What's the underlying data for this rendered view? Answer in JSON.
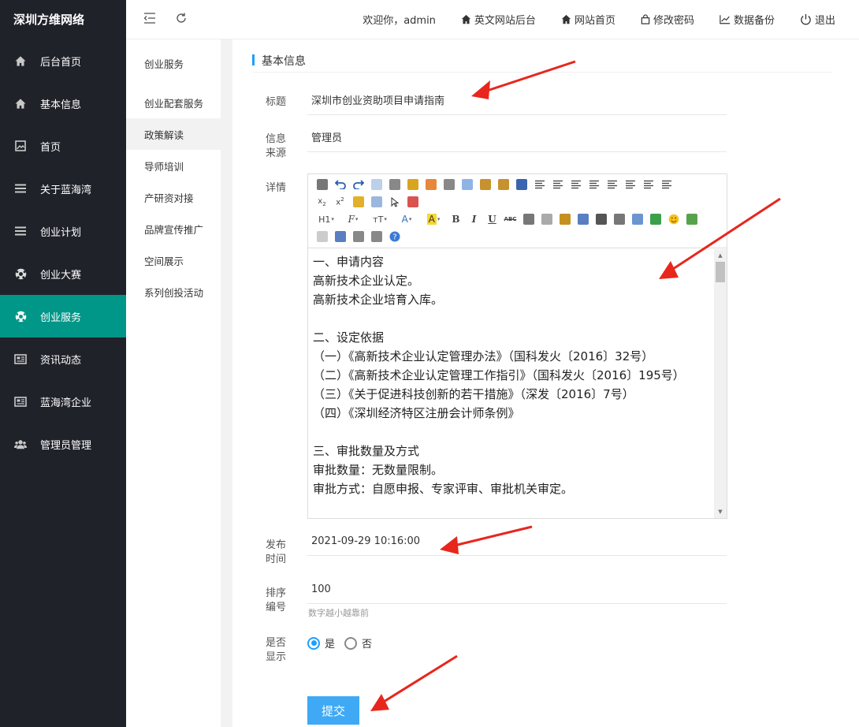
{
  "brand": "深圳方维网络",
  "sidebar": {
    "items": [
      {
        "label": "后台首页",
        "icon": "home-icon"
      },
      {
        "label": "基本信息",
        "icon": "home-icon"
      },
      {
        "label": "首页",
        "icon": "image-icon"
      },
      {
        "label": "关于蓝海湾",
        "icon": "list-icon"
      },
      {
        "label": "创业计划",
        "icon": "list-icon"
      },
      {
        "label": "创业大赛",
        "icon": "soccer-ball-icon"
      },
      {
        "label": "创业服务",
        "icon": "soccer-ball-icon",
        "active": true
      },
      {
        "label": "资讯动态",
        "icon": "newspaper-icon"
      },
      {
        "label": "蓝海湾企业",
        "icon": "newspaper-icon"
      },
      {
        "label": "管理员管理",
        "icon": "users-icon"
      }
    ]
  },
  "topbar": {
    "welcome": "欢迎你，admin",
    "english_backend": "英文网站后台",
    "site_home": "网站首页",
    "change_password": "修改密码",
    "data_backup": "数据备份",
    "logout": "退出"
  },
  "subnav": {
    "items": [
      "创业服务",
      "创业配套服务",
      "政策解读",
      "导师培训",
      "产研资对接",
      "品牌宣传推广",
      "空间展示",
      "系列创投活动"
    ],
    "active_index": 2
  },
  "form": {
    "section_title": "基本信息",
    "title_label": "标题",
    "title_value": "深圳市创业资助项目申请指南",
    "source_label_1": "信息",
    "source_label_2": "来源",
    "source_value": "管理员",
    "detail_label": "详情",
    "publish_label_1": "发布",
    "publish_label_2": "时间",
    "publish_value": "2021-09-29 10:16:00",
    "sort_label_1": "排序",
    "sort_label_2": "编号",
    "sort_value": "100",
    "sort_hint": "数字越小越靠前",
    "show_label_1": "是否",
    "show_label_2": "显示",
    "show_yes": "是",
    "show_no": "否",
    "show_selected": "是",
    "submit": "提交"
  },
  "editor": {
    "toolbar": {
      "heading": "H1",
      "font": "F",
      "size": "тT",
      "font_color": "A",
      "highlight": "A",
      "bold": "B",
      "italic": "I",
      "underline": "U",
      "strike": "ABC"
    },
    "lines": [
      "一、申请内容",
      "高新技术企业认定。",
      "高新技术企业培育入库。",
      "",
      "二、设定依据",
      "（一）《高新技术企业认定管理办法》（国科发火〔2016〕32号）",
      "（二）《高新技术企业认定管理工作指引》（国科发火〔2016〕195号）",
      "（三）《关于促进科技创新的若干措施》（深发〔2016〕7号）",
      "（四）《深圳经济特区注册会计师条例》",
      "",
      "三、审批数量及方式",
      "审批数量：无数量限制。",
      "审批方式：自愿申报、专家评审、审批机关审定。"
    ]
  },
  "colors": {
    "sidebar_bg": "#20222a",
    "active": "#009688",
    "accent": "#1e9fff",
    "submit": "#3fa9f5",
    "arrow": "#e8261c"
  }
}
